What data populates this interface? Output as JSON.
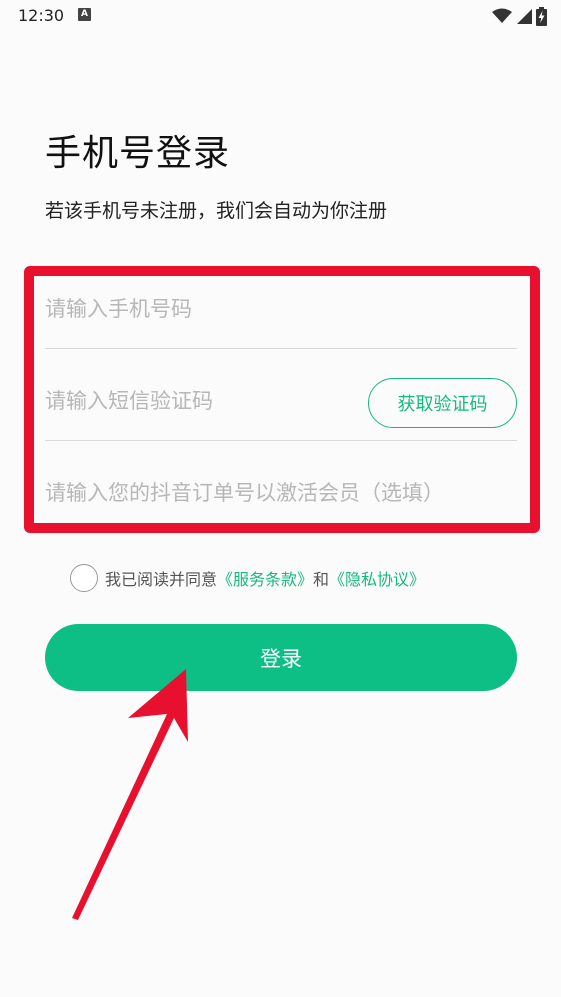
{
  "status_bar": {
    "time": "12:30",
    "notification_icon": "A",
    "icons": [
      "wifi-icon",
      "signal-icon",
      "battery-charging-icon"
    ]
  },
  "title": "手机号登录",
  "subtitle": "若该手机号未注册，我们会自动为你注册",
  "form": {
    "phone_placeholder": "请输入手机号码",
    "code_placeholder": "请输入短信验证码",
    "get_code_label": "获取验证码",
    "order_placeholder": "请输入您的抖音订单号以激活会员（选填）"
  },
  "agreement": {
    "prefix": "我已阅读并同意",
    "terms_link": "《服务条款》",
    "conjunction": "和",
    "privacy_link": "《隐私协议》"
  },
  "login_label": "登录",
  "colors": {
    "accent": "#0dbe85",
    "link": "#17b97e",
    "highlight": "#e8102f"
  }
}
